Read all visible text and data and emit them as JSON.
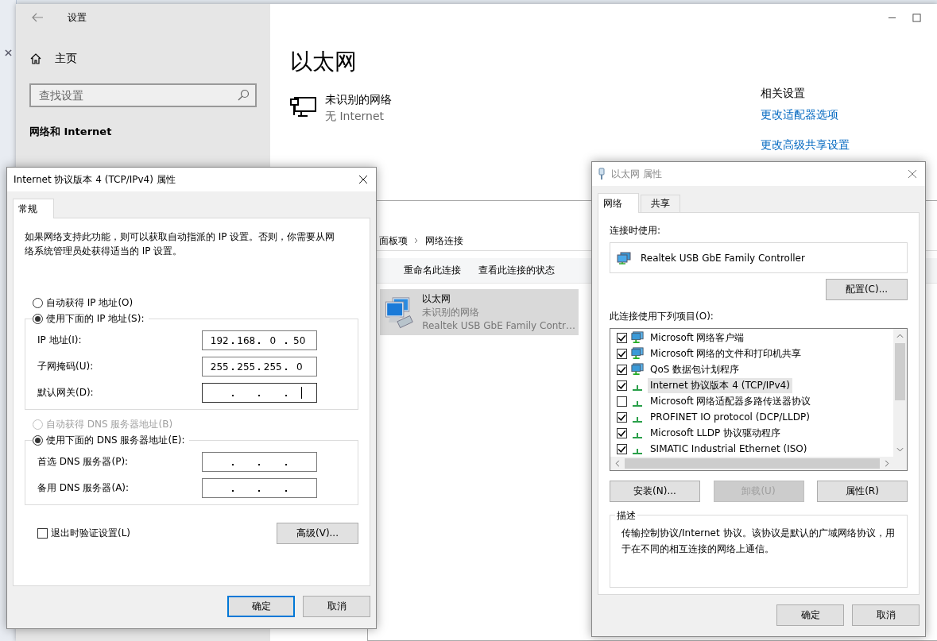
{
  "settings": {
    "title": "设置",
    "home": "主页",
    "search_placeholder": "查找设置",
    "section": "网络和 Internet",
    "heading": "以太网",
    "network_name": "未识别的网络",
    "network_status": "无 Internet",
    "related_title": "相关设置",
    "related_links": [
      "更改适配器选项",
      "更改高级共享设置"
    ]
  },
  "connections": {
    "breadcrumb": [
      "面板项",
      "网络连接"
    ],
    "toolbar": [
      "重命名此连接",
      "查看此连接的状态"
    ],
    "items": [
      {
        "name": "以太网",
        "status": "未识别的网络",
        "device": "Realtek USB GbE Family Contr…",
        "selected": true
      }
    ]
  },
  "ipv4_dialog": {
    "title": "Internet 协议版本 4 (TCP/IPv4) 属性",
    "tabs": [
      {
        "label": "常规",
        "selected": true
      }
    ],
    "intro": "如果网络支持此功能，则可以获取自动指派的 IP 设置。否则，你需要从网络系统管理员处获得适当的 IP 设置。",
    "ip_options": [
      {
        "label": "自动获得 IP 地址(O)",
        "selected": false,
        "disabled": false
      },
      {
        "label": "使用下面的 IP 地址(S):",
        "selected": true,
        "disabled": false
      }
    ],
    "ip_fields": [
      {
        "label": "IP 地址(I):",
        "octets": [
          "192",
          "168",
          "0",
          "50"
        ],
        "focused": false
      },
      {
        "label": "子网掩码(U):",
        "octets": [
          "255",
          "255",
          "255",
          "0"
        ],
        "focused": false
      },
      {
        "label": "默认网关(D):",
        "focused": true
      }
    ],
    "dns_options": [
      {
        "label": "自动获得 DNS 服务器地址(B)",
        "selected": false,
        "disabled": true
      },
      {
        "label": "使用下面的 DNS 服务器地址(E):",
        "selected": true,
        "disabled": false
      }
    ],
    "dns_fields": [
      {
        "label": "首选 DNS 服务器(P):",
        "focused": false
      },
      {
        "label": "备用 DNS 服务器(A):",
        "focused": false
      }
    ],
    "validate": {
      "label": "退出时验证设置(L)",
      "checked": false
    },
    "advanced_button": "高级(V)...",
    "buttons": [
      {
        "label": "确定",
        "default": true
      },
      {
        "label": "取消",
        "default": false
      }
    ]
  },
  "ethernet_dialog": {
    "title": "以太网 属性",
    "tabs": [
      {
        "label": "网络",
        "selected": true
      },
      {
        "label": "共享",
        "selected": false
      }
    ],
    "connect_using_label": "连接时使用:",
    "adapter": "Realtek USB GbE Family Controller",
    "configure_button": "配置(C)...",
    "items_label": "此连接使用下列项目(O):",
    "items": [
      {
        "label": "Microsoft 网络客户端",
        "kind": "client",
        "checked": true,
        "selected": false
      },
      {
        "label": "Microsoft 网络的文件和打印机共享",
        "kind": "service",
        "checked": true,
        "selected": false
      },
      {
        "label": "QoS 数据包计划程序",
        "kind": "service",
        "checked": true,
        "selected": false
      },
      {
        "label": "Internet 协议版本 4 (TCP/IPv4)",
        "kind": "protocol",
        "checked": true,
        "selected": true
      },
      {
        "label": "Microsoft 网络适配器多路传送器协议",
        "kind": "protocol",
        "checked": false,
        "selected": false
      },
      {
        "label": "PROFINET IO protocol (DCP/LLDP)",
        "kind": "protocol",
        "checked": true,
        "selected": false
      },
      {
        "label": "Microsoft LLDP 协议驱动程序",
        "kind": "protocol",
        "checked": true,
        "selected": false
      },
      {
        "label": "SIMATIC Industrial Ethernet (ISO)",
        "kind": "protocol",
        "checked": true,
        "selected": false
      }
    ],
    "item_buttons": [
      {
        "label": "安装(N)...",
        "disabled": false
      },
      {
        "label": "卸载(U)",
        "disabled": true
      },
      {
        "label": "属性(R)",
        "disabled": false
      }
    ],
    "description_label": "描述",
    "description": "传输控制协议/Internet 协议。该协议是默认的广域网络协议，用于在不同的相互连接的网络上通信。",
    "buttons": [
      {
        "label": "确定",
        "default": false
      },
      {
        "label": "取消",
        "default": false
      }
    ]
  }
}
